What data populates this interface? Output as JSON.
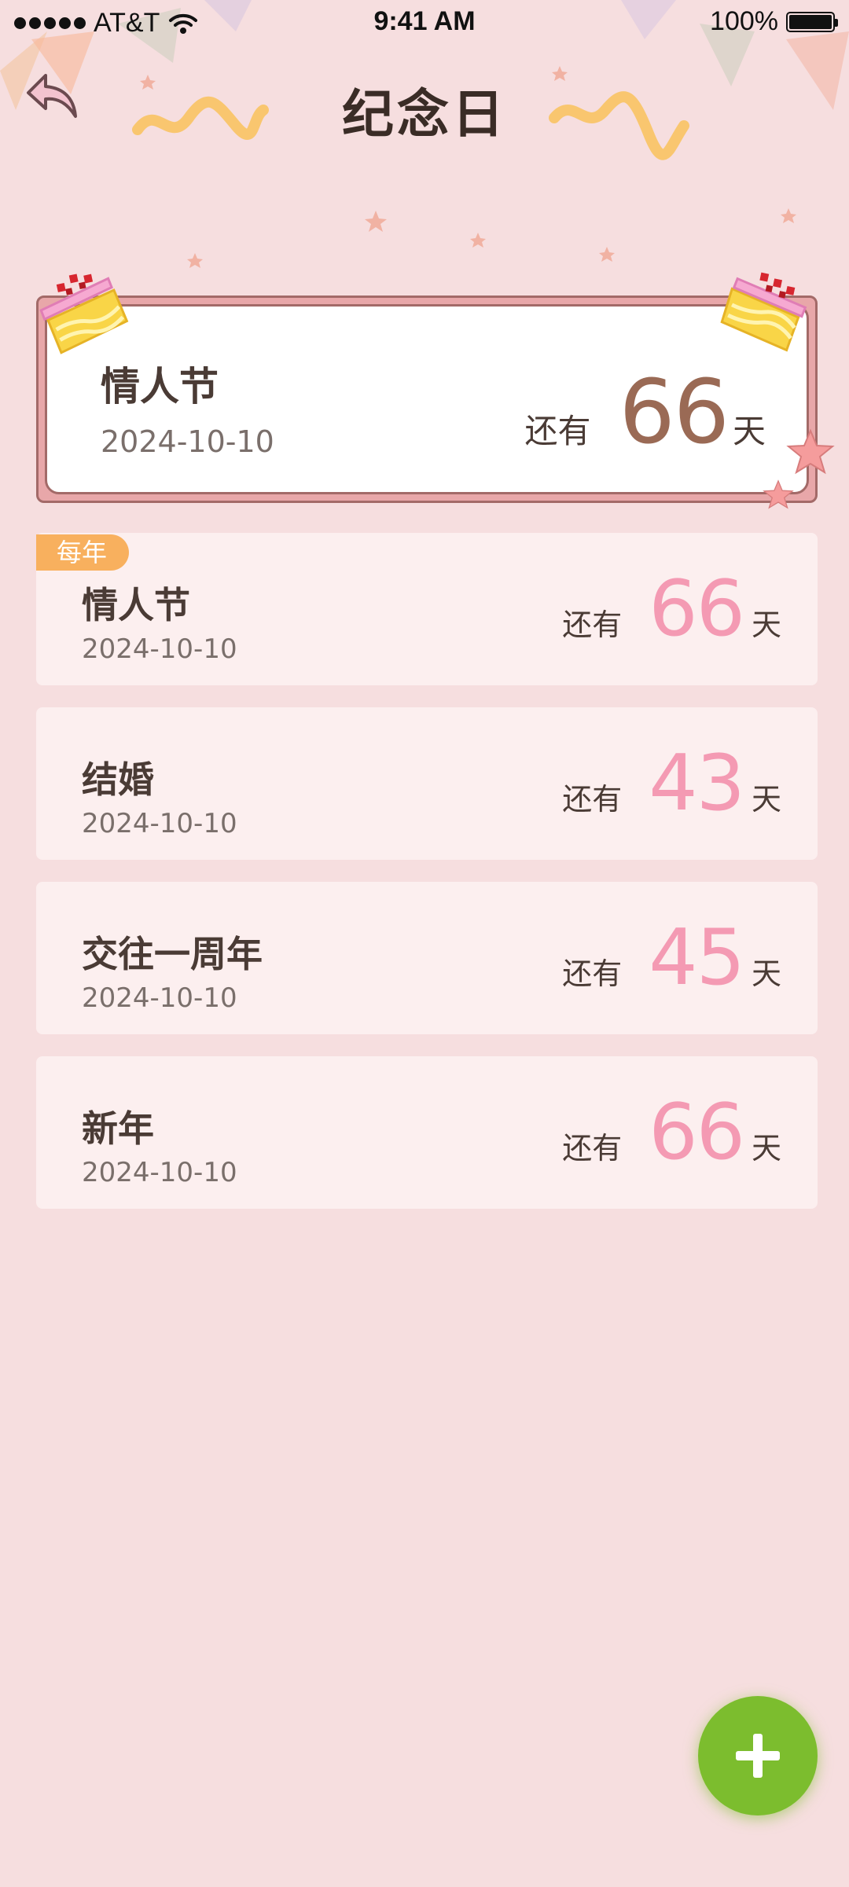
{
  "status_bar": {
    "carrier": "AT&T",
    "time": "9:41 AM",
    "battery": "100%",
    "battery_level": 1.0,
    "wifi_icon": "wifi-icon"
  },
  "header": {
    "title": "纪念日",
    "back_icon": "back-arrow-icon"
  },
  "featured": {
    "name": "情人节",
    "date": "2024-10-10",
    "prefix": "还有",
    "days": "66",
    "suffix": "天"
  },
  "events": [
    {
      "badge": "每年",
      "name": "情人节",
      "date": "2024-10-10",
      "prefix": "还有",
      "days": "66",
      "suffix": "天"
    },
    {
      "name": "结婚",
      "date": "2024-10-10",
      "prefix": "还有",
      "days": "43",
      "suffix": "天"
    },
    {
      "name": "交往一周年",
      "date": "2024-10-10",
      "prefix": "还有",
      "days": "45",
      "suffix": "天"
    },
    {
      "name": "新年",
      "date": "2024-10-10",
      "prefix": "还有",
      "days": "66",
      "suffix": "天"
    }
  ],
  "fab": {
    "icon": "plus-icon"
  },
  "colors": {
    "background": "#f6dedf",
    "card": "#fcefef",
    "accent_pink": "#f49ab3",
    "featured_number": "#9a6a55",
    "badge": "#f8b05e",
    "fab": "#7cbd2e"
  }
}
